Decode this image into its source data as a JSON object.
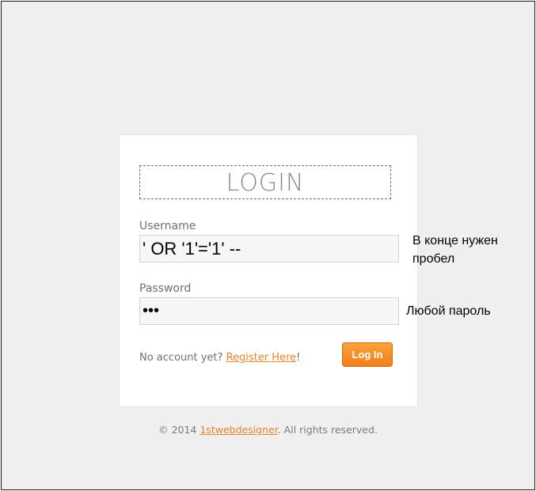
{
  "login": {
    "title": "LOGIN",
    "username_label": "Username",
    "username_value": "' OR '1'='1' --",
    "password_label": "Password",
    "password_value": "•••",
    "register_prefix": "No account yet? ",
    "register_link": "Register Here",
    "register_suffix": "!",
    "login_button": "Log In"
  },
  "annotations": {
    "username_note_line1": "В конце нужен",
    "username_note_line2": "пробел",
    "password_note": "Любой пароль"
  },
  "footer": {
    "prefix": "© 2014 ",
    "link": "1stwebdesigner",
    "suffix": ". All rights reserved."
  },
  "colors": {
    "accent": "#e8832a",
    "button": "#f28c24",
    "background": "#f0f0f0"
  }
}
